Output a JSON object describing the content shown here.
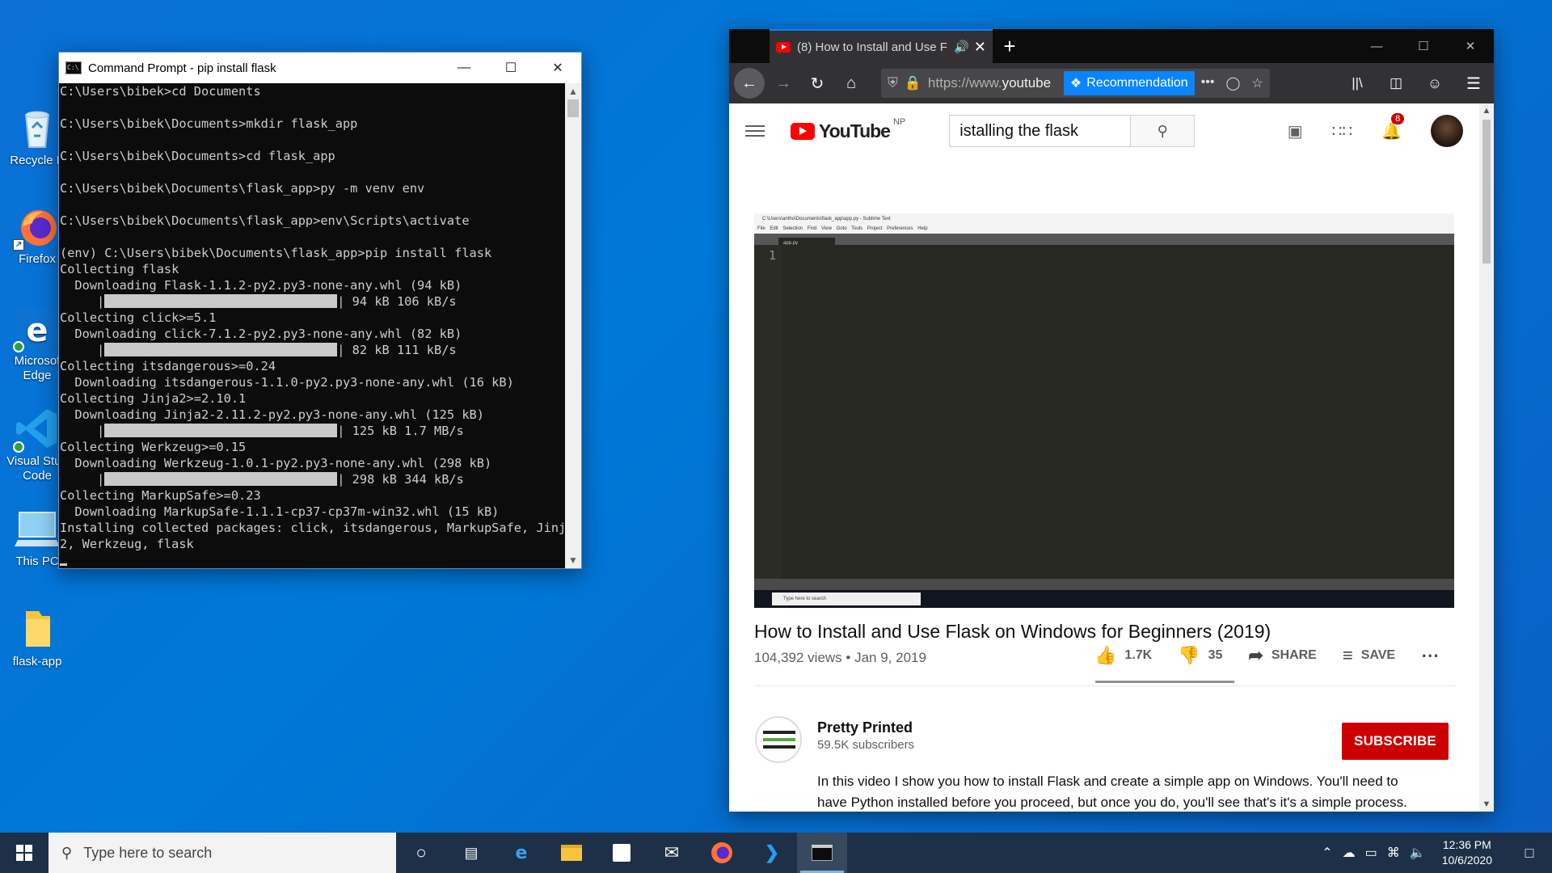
{
  "desktop": {
    "icons": [
      {
        "label": "Recycle B",
        "icon": "recycle-bin-icon"
      },
      {
        "label": "Firefox",
        "icon": "firefox-icon"
      },
      {
        "label": "Microsof Edge",
        "icon": "edge-icon"
      },
      {
        "label": "Visual Stud Code",
        "icon": "vscode-icon"
      },
      {
        "label": "This PC",
        "icon": "this-pc-icon"
      },
      {
        "label": "flask-app",
        "icon": "folder-icon"
      }
    ],
    "background_color": "#0078d7"
  },
  "cmd": {
    "title": "Command Prompt - pip  install flask",
    "lines": [
      "C:\\Users\\bibek>cd Documents",
      "",
      "C:\\Users\\bibek\\Documents>mkdir flask_app",
      "",
      "C:\\Users\\bibek\\Documents>cd flask_app",
      "",
      "C:\\Users\\bibek\\Documents\\flask_app>py -m venv env",
      "",
      "C:\\Users\\bibek\\Documents\\flask_app>env\\Scripts\\activate",
      "",
      "(env) C:\\Users\\bibek\\Documents\\flask_app>pip install flask",
      "Collecting flask",
      "  Downloading Flask-1.1.2-py2.py3-none-any.whl (94 kB)",
      "     |",
      "Collecting click>=5.1",
      "  Downloading click-7.1.2-py2.py3-none-any.whl (82 kB)",
      "     |",
      "Collecting itsdangerous>=0.24",
      "  Downloading itsdangerous-1.1.0-py2.py3-none-any.whl (16 kB)",
      "Collecting Jinja2>=2.10.1",
      "  Downloading Jinja2-2.11.2-py2.py3-none-any.whl (125 kB)",
      "     |",
      "Collecting Werkzeug>=0.15",
      "  Downloading Werkzeug-1.0.1-py2.py3-none-any.whl (298 kB)",
      "     |",
      "Collecting MarkupSafe>=0.23",
      "  Downloading MarkupSafe-1.1.1-cp37-cp37m-win32.whl (15 kB)",
      "Installing collected packages: click, itsdangerous, MarkupSafe, Jinja",
      "2, Werkzeug, flask",
      ""
    ],
    "progress_suffixes": {
      "13": "| 94 kB 106 kB/s",
      "16": "| 82 kB 111 kB/s",
      "21": "| 125 kB 1.7 MB/s",
      "24": "| 298 kB 344 kB/s"
    }
  },
  "browser": {
    "tab_title": "(8) How to Install and Use F",
    "url_gray": "https://www.",
    "url_host": "youtube",
    "recommendation_label": "Recommendation",
    "accent_color": "#0a84ff"
  },
  "youtube": {
    "logo_text": "YouTube",
    "region": "NP",
    "search_value": "istalling the flask",
    "notification_count": "8",
    "video": {
      "title": "How to Install and Use Flask on Windows for Beginners (2019)",
      "views_date": "104,392 views • Jan 9, 2019",
      "likes": "1.7K",
      "dislikes": "35",
      "share": "SHARE",
      "save": "SAVE"
    },
    "player": {
      "window_title": "C:\\Users\\antho\\Documents\\flask_app\\app.py - Sublime Text",
      "menu": "File Edit Selection Find View Goto Tools Project Preferences Help",
      "tab": "app.py",
      "line_number": "1",
      "taskbar_search": "Type here to search"
    },
    "channel": {
      "name": "Pretty Printed",
      "subscribers": "59.5K subscribers",
      "subscribe_label": "SUBSCRIBE",
      "subscribe_color": "#cc0000"
    },
    "description": "In this video I show you how to install Flask and create a simple app on Windows. You'll need to have Python installed before you proceed, but once you do, you'll see that's it's a simple process."
  },
  "taskbar": {
    "search_placeholder": "Type here to search",
    "time": "12:36 PM",
    "date": "10/6/2020",
    "pinned": [
      "cortana-icon",
      "task-view-icon",
      "edge-icon",
      "file-explorer-icon",
      "store-icon",
      "mail-icon",
      "firefox-icon",
      "vscode-icon",
      "cmd-icon"
    ]
  }
}
